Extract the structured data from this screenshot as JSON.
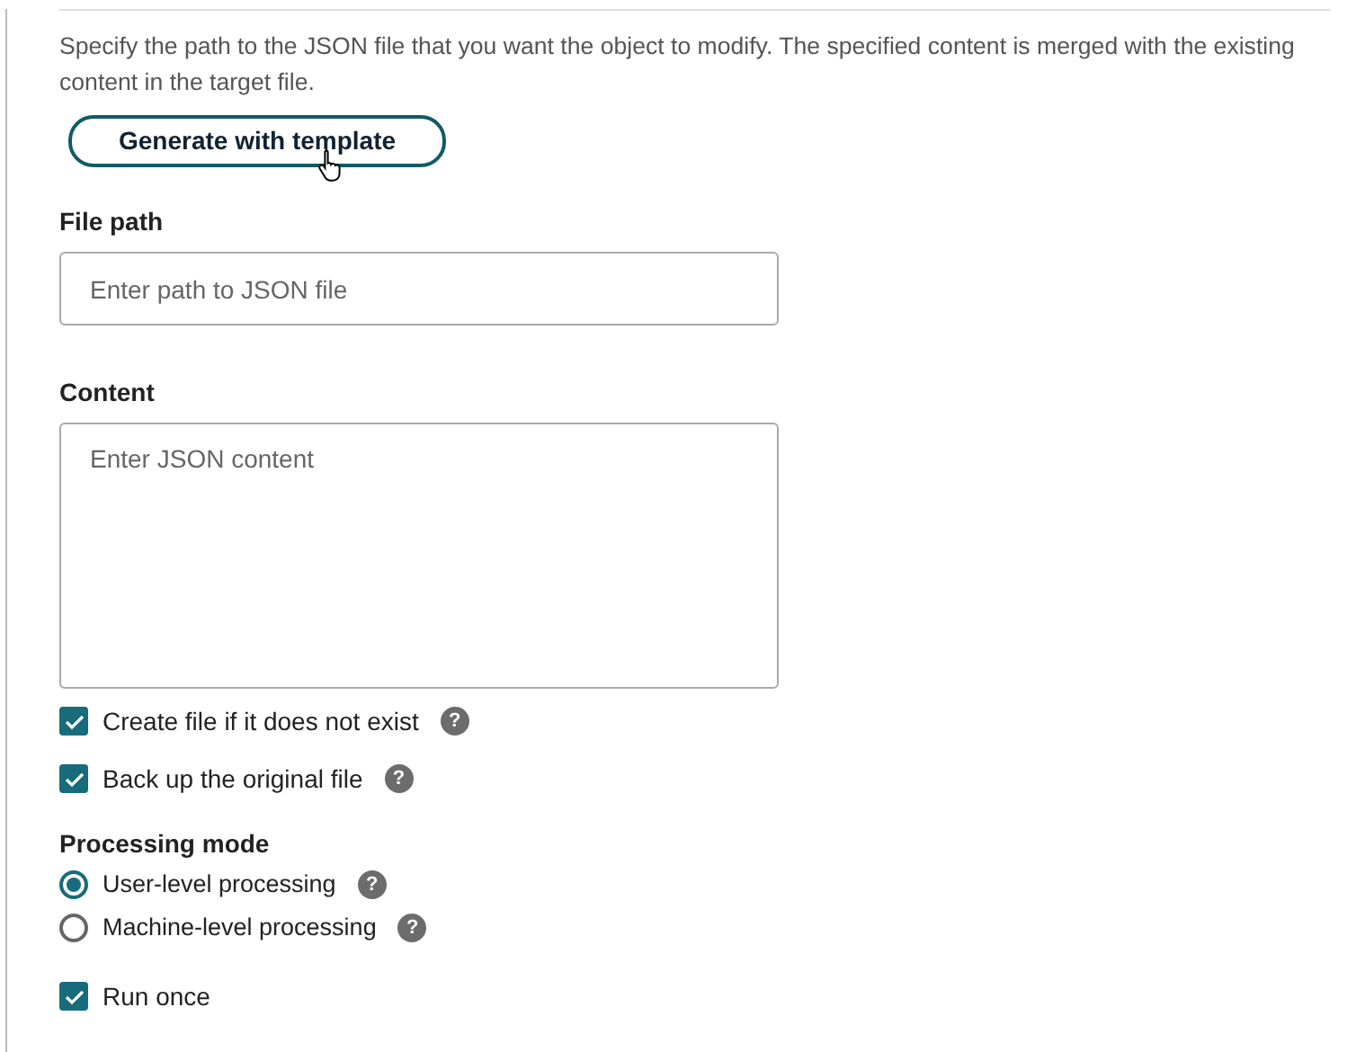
{
  "description": "Specify the path to the JSON file that you want the object to modify. The specified content is merged with the existing content in the target file.",
  "template_button": "Generate with template",
  "file_path": {
    "label": "File path",
    "placeholder": "Enter path to JSON file"
  },
  "content": {
    "label": "Content",
    "placeholder": "Enter JSON content"
  },
  "options": [
    {
      "label": "Create file if it does not exist",
      "checked": true,
      "help": "?"
    },
    {
      "label": "Back up the original file",
      "checked": true,
      "help": "?"
    }
  ],
  "processing_mode": {
    "label": "Processing mode",
    "choices": [
      {
        "label": "User-level processing",
        "selected": true,
        "help": "?"
      },
      {
        "label": "Machine-level processing",
        "selected": false,
        "help": "?"
      }
    ]
  },
  "run_once": {
    "label": "Run once",
    "checked": true
  }
}
